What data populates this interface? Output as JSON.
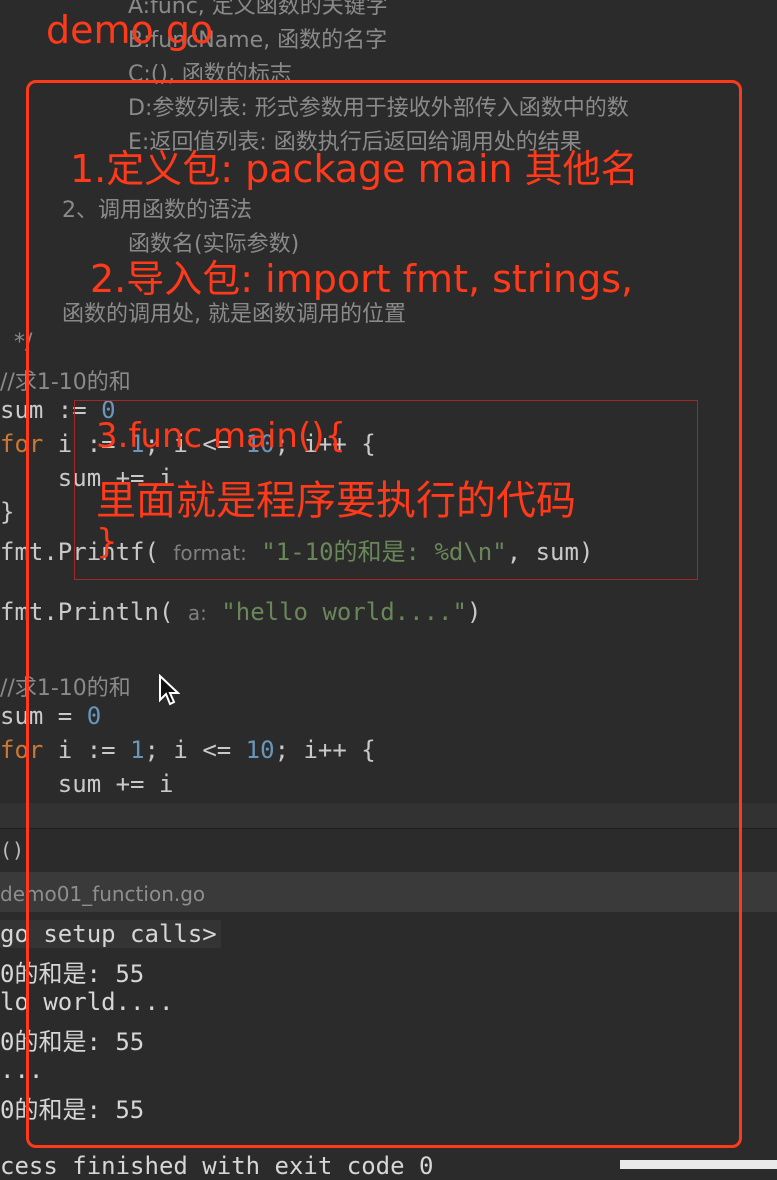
{
  "comment_block": {
    "line_a": "A:func, 定义函数的关键字",
    "line_b": "B:funcName, 函数的名字",
    "line_c": "C:(), 函数的标志",
    "line_d": "D:参数列表: 形式参数用于接收外部传入函数中的数",
    "line_e": "E:返回值列表: 函数执行后返回给调用处的结果",
    "line_2": "2、调用函数的语法",
    "line_call": "函数名(实际参数)",
    "line_callsite": "函数的调用处, 就是函数调用的位置",
    "line_end": "*/"
  },
  "code": {
    "c1": "//求1-10的和",
    "l1_var": "sum := ",
    "l1_num": "0",
    "l2_kw": "for",
    "l2_a": " i := ",
    "l2_n1": "1",
    "l2_b": "; i <= ",
    "l2_n2": "10",
    "l2_c": "; i++ {",
    "l3": "    sum += i",
    "l4": "}",
    "l5_fn": "fmt.Printf( ",
    "l5_hint": "format:",
    "l5_str": " \"1-10的和是: %d\\n\"",
    "l5_rest": ", sum)",
    "l6_fn": "fmt.Println( ",
    "l6_hint": "a:",
    "l6_str": " \"hello world....\"",
    "l6_rest": ")",
    "c2": "//求1-10的和",
    "m1_var": "sum = ",
    "m1_num": "0",
    "m2_kw": "for",
    "m2_a": " i := ",
    "m2_n1": "1",
    "m2_b": "; i <= ",
    "m2_n2": "10",
    "m2_c": "; i++ {",
    "m3": "    sum += i"
  },
  "bottom": {
    "func_crumb": "()",
    "file_tab": "demo01_function.go",
    "out1": "go setup calls>",
    "out2": "0的和是: 55",
    "out3": "lo world....",
    "out4": "0的和是: 55",
    "out5": "...",
    "out6": "0的和是: 55",
    "out7": "cess finished with exit code 0"
  },
  "annotations": {
    "title": "demo go",
    "a1": "1.定义包: package main 其他名",
    "a2": "2.导入包: import fmt, strings,",
    "a3": "3.func main(){",
    "a4": "里面就是程序要执行的代码",
    "a5": "}"
  },
  "colors": {
    "annotation": "#ff3a1a",
    "keyword": "#cc7832",
    "number": "#6897bb",
    "string": "#6a8759",
    "background": "#2b2b2b"
  },
  "icons": {
    "mouse": "mouse-pointer-icon"
  }
}
